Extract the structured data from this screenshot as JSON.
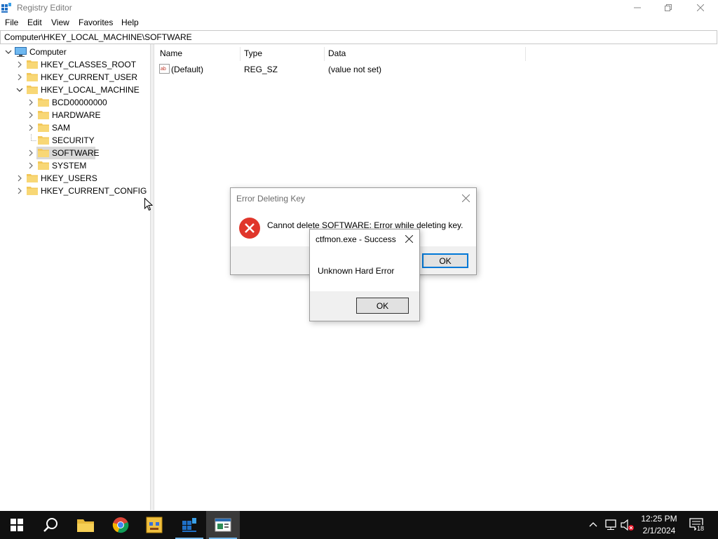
{
  "window": {
    "title": "Registry Editor"
  },
  "menu": [
    "File",
    "Edit",
    "View",
    "Favorites",
    "Help"
  ],
  "address": "Computer\\HKEY_LOCAL_MACHINE\\SOFTWARE",
  "tree": {
    "root": "Computer",
    "hives": [
      "HKEY_CLASSES_ROOT",
      "HKEY_CURRENT_USER",
      "HKEY_LOCAL_MACHINE",
      "HKEY_USERS",
      "HKEY_CURRENT_CONFIG"
    ],
    "hklm_children": [
      "BCD00000000",
      "HARDWARE",
      "SAM",
      "SECURITY",
      "SOFTWARE",
      "SYSTEM"
    ],
    "selected": "SOFTWARE"
  },
  "list": {
    "columns": [
      "Name",
      "Type",
      "Data"
    ],
    "rows": [
      {
        "name": "(Default)",
        "type": "REG_SZ",
        "data": "(value not set)"
      }
    ]
  },
  "error_dialog": {
    "title": "Error Deleting Key",
    "message": "Cannot delete SOFTWARE:  Error while deleting key.",
    "ok": "OK"
  },
  "ctfmon_dialog": {
    "title": "ctfmon.exe - Success",
    "message": "Unknown Hard Error",
    "ok": "OK"
  },
  "taskbar": {
    "time": "12:25 PM",
    "date": "2/1/2024",
    "notification_count": "18"
  },
  "colors": {
    "accent": "#0078d7",
    "folder": "#f3c85a",
    "error_red": "#e0362b",
    "taskbar": "#101010"
  }
}
